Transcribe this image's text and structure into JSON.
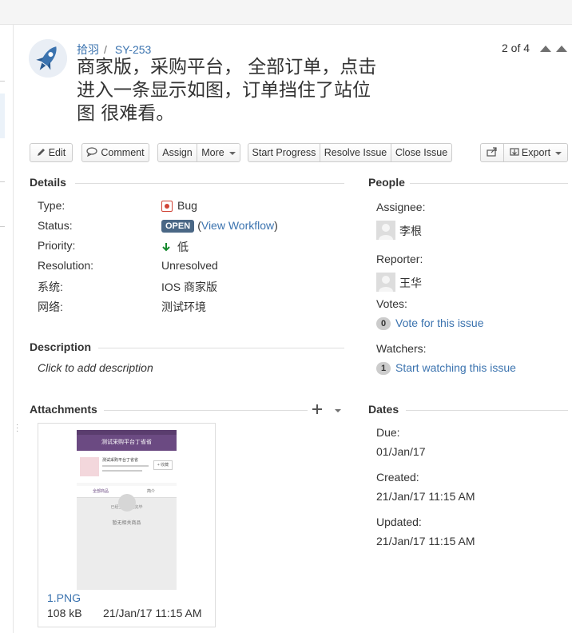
{
  "breadcrumb": {
    "project": "拾羽",
    "issue_key": "SY-253"
  },
  "summary": "商家版，采购平台， 全部订单，点击进入一条显示如图，订单挡住了站位图 很难看。",
  "pager": {
    "text": "2 of 4"
  },
  "toolbar": {
    "edit": "Edit",
    "comment": "Comment",
    "assign": "Assign",
    "more": "More",
    "start_progress": "Start Progress",
    "resolve_issue": "Resolve Issue",
    "close_issue": "Close Issue",
    "export": "Export"
  },
  "details": {
    "title": "Details",
    "type_label": "Type:",
    "type_value": "Bug",
    "status_label": "Status:",
    "status_value": "OPEN",
    "view_workflow_open": "(",
    "view_workflow": "View Workflow",
    "view_workflow_close": ")",
    "priority_label": "Priority:",
    "priority_value": "低",
    "resolution_label": "Resolution:",
    "resolution_value": "Unresolved",
    "system_label": "系统:",
    "system_value": "IOS 商家版",
    "network_label": "网络:",
    "network_value": "测试环境"
  },
  "description": {
    "title": "Description",
    "placeholder": "Click to add description"
  },
  "attachments": {
    "title": "Attachments",
    "file": {
      "name": "1.PNG",
      "size": "108 kB",
      "date": "21/Jan/17 11:15 AM"
    },
    "thumbnail": {
      "header": "测试采购平台丁省省",
      "shop_name": "测试采购平台丁省省",
      "follow": "+ 收藏",
      "tab_all": "全部商品",
      "tab_intro": "简介",
      "notice": "已经全部加载完毕",
      "empty_text": "暂无相关商品"
    }
  },
  "people": {
    "title": "People",
    "assignee_label": "Assignee:",
    "assignee": "李根",
    "reporter_label": "Reporter:",
    "reporter": "王华",
    "votes_label": "Votes:",
    "votes_count": "0",
    "vote_link": "Vote for this issue",
    "watchers_label": "Watchers:",
    "watchers_count": "1",
    "watch_link": "Start watching this issue"
  },
  "dates": {
    "title": "Dates",
    "due_label": "Due:",
    "due": "01/Jan/17",
    "created_label": "Created:",
    "created": "21/Jan/17 11:15 AM",
    "updated_label": "Updated:",
    "updated": "21/Jan/17 11:15 AM"
  },
  "colors": {
    "link": "#3b73af",
    "status_open": "#4a6785",
    "bug": "#d04437",
    "thumb_header": "#6b4a82"
  }
}
